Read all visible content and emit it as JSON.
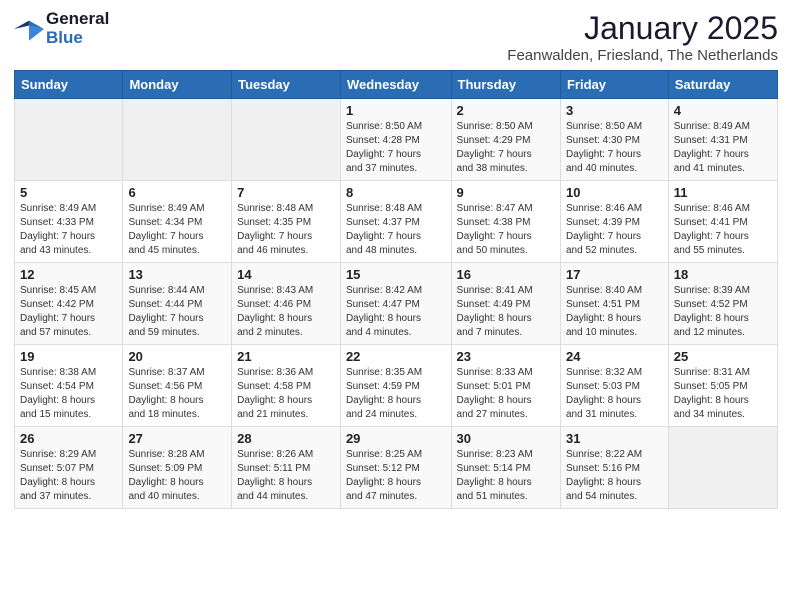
{
  "header": {
    "logo_general": "General",
    "logo_blue": "Blue",
    "month_title": "January 2025",
    "location": "Feanwalden, Friesland, The Netherlands"
  },
  "weekdays": [
    "Sunday",
    "Monday",
    "Tuesday",
    "Wednesday",
    "Thursday",
    "Friday",
    "Saturday"
  ],
  "weeks": [
    [
      {
        "day": "",
        "info": ""
      },
      {
        "day": "",
        "info": ""
      },
      {
        "day": "",
        "info": ""
      },
      {
        "day": "1",
        "info": "Sunrise: 8:50 AM\nSunset: 4:28 PM\nDaylight: 7 hours\nand 37 minutes."
      },
      {
        "day": "2",
        "info": "Sunrise: 8:50 AM\nSunset: 4:29 PM\nDaylight: 7 hours\nand 38 minutes."
      },
      {
        "day": "3",
        "info": "Sunrise: 8:50 AM\nSunset: 4:30 PM\nDaylight: 7 hours\nand 40 minutes."
      },
      {
        "day": "4",
        "info": "Sunrise: 8:49 AM\nSunset: 4:31 PM\nDaylight: 7 hours\nand 41 minutes."
      }
    ],
    [
      {
        "day": "5",
        "info": "Sunrise: 8:49 AM\nSunset: 4:33 PM\nDaylight: 7 hours\nand 43 minutes."
      },
      {
        "day": "6",
        "info": "Sunrise: 8:49 AM\nSunset: 4:34 PM\nDaylight: 7 hours\nand 45 minutes."
      },
      {
        "day": "7",
        "info": "Sunrise: 8:48 AM\nSunset: 4:35 PM\nDaylight: 7 hours\nand 46 minutes."
      },
      {
        "day": "8",
        "info": "Sunrise: 8:48 AM\nSunset: 4:37 PM\nDaylight: 7 hours\nand 48 minutes."
      },
      {
        "day": "9",
        "info": "Sunrise: 8:47 AM\nSunset: 4:38 PM\nDaylight: 7 hours\nand 50 minutes."
      },
      {
        "day": "10",
        "info": "Sunrise: 8:46 AM\nSunset: 4:39 PM\nDaylight: 7 hours\nand 52 minutes."
      },
      {
        "day": "11",
        "info": "Sunrise: 8:46 AM\nSunset: 4:41 PM\nDaylight: 7 hours\nand 55 minutes."
      }
    ],
    [
      {
        "day": "12",
        "info": "Sunrise: 8:45 AM\nSunset: 4:42 PM\nDaylight: 7 hours\nand 57 minutes."
      },
      {
        "day": "13",
        "info": "Sunrise: 8:44 AM\nSunset: 4:44 PM\nDaylight: 7 hours\nand 59 minutes."
      },
      {
        "day": "14",
        "info": "Sunrise: 8:43 AM\nSunset: 4:46 PM\nDaylight: 8 hours\nand 2 minutes."
      },
      {
        "day": "15",
        "info": "Sunrise: 8:42 AM\nSunset: 4:47 PM\nDaylight: 8 hours\nand 4 minutes."
      },
      {
        "day": "16",
        "info": "Sunrise: 8:41 AM\nSunset: 4:49 PM\nDaylight: 8 hours\nand 7 minutes."
      },
      {
        "day": "17",
        "info": "Sunrise: 8:40 AM\nSunset: 4:51 PM\nDaylight: 8 hours\nand 10 minutes."
      },
      {
        "day": "18",
        "info": "Sunrise: 8:39 AM\nSunset: 4:52 PM\nDaylight: 8 hours\nand 12 minutes."
      }
    ],
    [
      {
        "day": "19",
        "info": "Sunrise: 8:38 AM\nSunset: 4:54 PM\nDaylight: 8 hours\nand 15 minutes."
      },
      {
        "day": "20",
        "info": "Sunrise: 8:37 AM\nSunset: 4:56 PM\nDaylight: 8 hours\nand 18 minutes."
      },
      {
        "day": "21",
        "info": "Sunrise: 8:36 AM\nSunset: 4:58 PM\nDaylight: 8 hours\nand 21 minutes."
      },
      {
        "day": "22",
        "info": "Sunrise: 8:35 AM\nSunset: 4:59 PM\nDaylight: 8 hours\nand 24 minutes."
      },
      {
        "day": "23",
        "info": "Sunrise: 8:33 AM\nSunset: 5:01 PM\nDaylight: 8 hours\nand 27 minutes."
      },
      {
        "day": "24",
        "info": "Sunrise: 8:32 AM\nSunset: 5:03 PM\nDaylight: 8 hours\nand 31 minutes."
      },
      {
        "day": "25",
        "info": "Sunrise: 8:31 AM\nSunset: 5:05 PM\nDaylight: 8 hours\nand 34 minutes."
      }
    ],
    [
      {
        "day": "26",
        "info": "Sunrise: 8:29 AM\nSunset: 5:07 PM\nDaylight: 8 hours\nand 37 minutes."
      },
      {
        "day": "27",
        "info": "Sunrise: 8:28 AM\nSunset: 5:09 PM\nDaylight: 8 hours\nand 40 minutes."
      },
      {
        "day": "28",
        "info": "Sunrise: 8:26 AM\nSunset: 5:11 PM\nDaylight: 8 hours\nand 44 minutes."
      },
      {
        "day": "29",
        "info": "Sunrise: 8:25 AM\nSunset: 5:12 PM\nDaylight: 8 hours\nand 47 minutes."
      },
      {
        "day": "30",
        "info": "Sunrise: 8:23 AM\nSunset: 5:14 PM\nDaylight: 8 hours\nand 51 minutes."
      },
      {
        "day": "31",
        "info": "Sunrise: 8:22 AM\nSunset: 5:16 PM\nDaylight: 8 hours\nand 54 minutes."
      },
      {
        "day": "",
        "info": ""
      }
    ]
  ]
}
